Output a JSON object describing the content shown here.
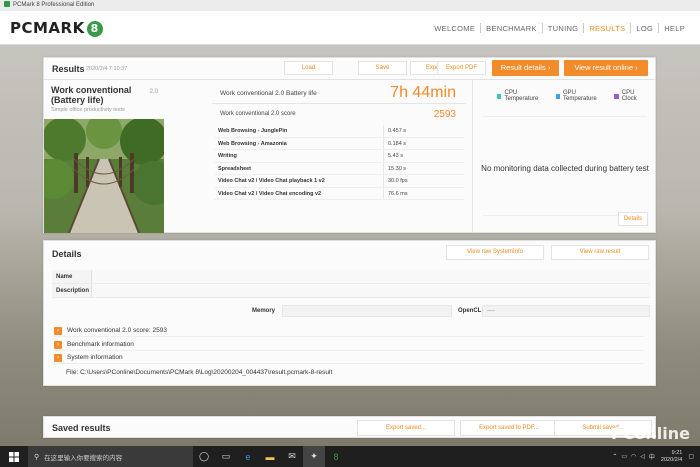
{
  "window": {
    "title": "PCMark 8 Professional Edition"
  },
  "logo": {
    "text": "PCMARK",
    "badge": "8"
  },
  "nav": {
    "items": [
      "WELCOME",
      "BENCHMARK",
      "TUNING",
      "RESULTS",
      "LOG",
      "HELP"
    ],
    "active": "RESULTS"
  },
  "results": {
    "title": "Results",
    "date": "2020/2/4 7:10:37",
    "buttons": {
      "load": "Load",
      "save": "Save",
      "export": "Export",
      "export_pdf": "Export PDF"
    },
    "result_details": "Result details",
    "view_online": "View result online",
    "test": {
      "name": "Work conventional (Battery life)",
      "version": "2.0",
      "description": "Simple office productivity tests"
    },
    "battery_life_label": "Work conventional 2.0 Battery life",
    "battery_life_value": "7h 44min",
    "score_label": "Work conventional 2.0 score",
    "score_value": "2593",
    "subscores": [
      {
        "name": "Web Browsing - JunglePin",
        "value": "0.457 s"
      },
      {
        "name": "Web Browsing - Amazonia",
        "value": "0.184 s"
      },
      {
        "name": "Writing",
        "value": "5.43 s"
      },
      {
        "name": "Spreadsheet",
        "value": "15.30 s"
      },
      {
        "name": "Video Chat v2 / Video Chat playback 1 v2",
        "value": "30.0 fps"
      },
      {
        "name": "Video Chat v2 / Video Chat encoding v2",
        "value": "76.6 ms"
      }
    ],
    "monitor": {
      "legend": [
        "CPU Temperature",
        "GPU Temperature",
        "CPU Clock"
      ],
      "no_data": "No monitoring data collected during battery test",
      "details_button": "Details"
    }
  },
  "details": {
    "title": "Details",
    "view_sysinfo": "View raw SystemInfo",
    "view_result": "View raw result",
    "fields": {
      "name": "Name",
      "description": "Description",
      "memory": "Memory",
      "opencl": "OpenCL",
      "opencl_value": "----"
    },
    "expanders": [
      "Work conventional 2.0 score: 2593",
      "Benchmark information",
      "System information"
    ],
    "file": "File: C:\\Users\\PConline\\Documents\\PCMark 8\\Log\\20200204_004437\\result.pcmark-8-result"
  },
  "saved": {
    "title": "Saved results",
    "export_saved": "Export saved...",
    "export_pdf": "Export saved to PDF...",
    "submit": "Submit saved..."
  },
  "taskbar": {
    "search_placeholder": "在这里输入你要搜索的内容",
    "ime": "中",
    "time": "9:21",
    "date": "2020/2/4"
  },
  "watermark": "PConline",
  "colors": {
    "accent": "#f28b2a",
    "cpu_temp": "#3cc6c0",
    "gpu_temp": "#3ea4e0",
    "cpu_clock": "#9a5bd0"
  }
}
